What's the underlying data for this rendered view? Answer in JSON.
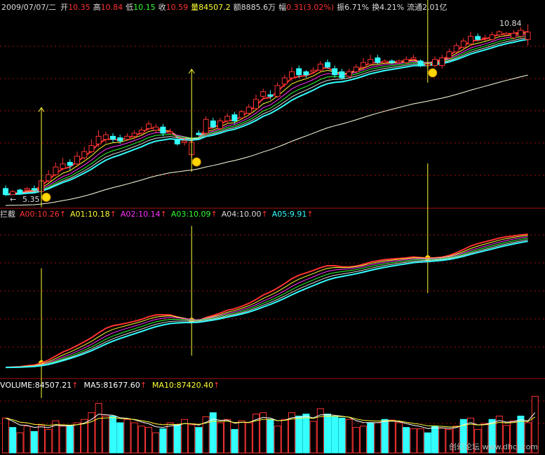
{
  "header": {
    "date": "2009/07/07/二",
    "open_label": "开",
    "open": "10.35",
    "high_label": "高",
    "high": "10.84",
    "low_label": "低",
    "low": "10.15",
    "close_label": "收",
    "close": "10.59",
    "volume_label": "量",
    "volume": "84507.2",
    "amount_label": "额",
    "amount": "8885.6万",
    "change_label": "幅",
    "change": "0.31(3.02%)",
    "amplitude_label": "振",
    "amplitude": "6.71%",
    "turnover_label": "换",
    "turnover": "4.21%",
    "float_label": "流通",
    "float": "2.01亿"
  },
  "indicator": {
    "name": "拦截",
    "lines": [
      {
        "label": "A00:10.26",
        "color": "#ff3333"
      },
      {
        "label": "A01:10.18",
        "color": "#ffff33"
      },
      {
        "label": "A02:10.14",
        "color": "#ff33ff"
      },
      {
        "label": "A03:10.09",
        "color": "#33ff33"
      },
      {
        "label": "A04:10.00",
        "color": "#dddddd"
      },
      {
        "label": "A05:9.91",
        "color": "#33ffff"
      }
    ]
  },
  "volume_panel": {
    "lines": [
      {
        "label": "VOLUME:84507.21",
        "color": "#ffffff"
      },
      {
        "label": "MA5:81677.60",
        "color": "#ffffff"
      },
      {
        "label": "MA10:87420.40",
        "color": "#ffff33"
      }
    ]
  },
  "colors": {
    "up": "#ff3333",
    "down": "#33ffff",
    "signal": "#ffff33",
    "grid": "#a01010",
    "ma_long": "#ffffe0"
  },
  "watermark": "创幻论坛 www.dhcj.com",
  "chart_data": [
    {
      "type": "candlestick",
      "annotations": [
        {
          "text": "10.84",
          "at": "high"
        },
        {
          "text": "5.35",
          "at": "low"
        }
      ],
      "candles": [
        {
          "o": 5.5,
          "c": 5.3,
          "h": 5.6,
          "l": 5.25
        },
        {
          "o": 5.3,
          "c": 5.4,
          "h": 5.45,
          "l": 5.3
        },
        {
          "o": 5.45,
          "c": 5.35,
          "h": 5.5,
          "l": 5.3
        },
        {
          "o": 5.45,
          "c": 5.5,
          "h": 5.55,
          "l": 5.4
        },
        {
          "o": 5.5,
          "c": 5.45,
          "h": 5.6,
          "l": 5.4
        },
        {
          "o": 5.4,
          "c": 5.75,
          "h": 5.85,
          "l": 5.35
        },
        {
          "o": 5.75,
          "c": 5.95,
          "h": 6.1,
          "l": 5.7
        },
        {
          "o": 5.95,
          "c": 6.2,
          "h": 6.35,
          "l": 5.9
        },
        {
          "o": 6.15,
          "c": 6.3,
          "h": 6.5,
          "l": 6.1
        },
        {
          "o": 6.35,
          "c": 6.25,
          "h": 6.45,
          "l": 6.1
        },
        {
          "o": 6.3,
          "c": 6.55,
          "h": 6.7,
          "l": 6.2
        },
        {
          "o": 6.5,
          "c": 6.7,
          "h": 6.85,
          "l": 6.45
        },
        {
          "o": 6.7,
          "c": 6.9,
          "h": 7.1,
          "l": 6.65
        },
        {
          "o": 6.95,
          "c": 7.2,
          "h": 7.4,
          "l": 6.85
        },
        {
          "o": 7.1,
          "c": 7.25,
          "h": 7.35,
          "l": 7.0
        },
        {
          "o": 7.2,
          "c": 7.1,
          "h": 7.3,
          "l": 7.0
        },
        {
          "o": 7.15,
          "c": 7.05,
          "h": 7.25,
          "l": 6.95
        },
        {
          "o": 7.1,
          "c": 7.2,
          "h": 7.3,
          "l": 7.05
        },
        {
          "o": 7.2,
          "c": 7.3,
          "h": 7.4,
          "l": 7.1
        },
        {
          "o": 7.3,
          "c": 7.4,
          "h": 7.5,
          "l": 7.25
        },
        {
          "o": 7.45,
          "c": 7.6,
          "h": 7.7,
          "l": 7.4
        },
        {
          "o": 7.4,
          "c": 7.5,
          "h": 7.6,
          "l": 7.3
        },
        {
          "o": 7.5,
          "c": 7.3,
          "h": 7.6,
          "l": 7.2
        },
        {
          "o": 7.3,
          "c": 7.35,
          "h": 7.45,
          "l": 7.25
        },
        {
          "o": 7.1,
          "c": 6.95,
          "h": 7.2,
          "l": 6.9
        },
        {
          "o": 7.0,
          "c": 7.05,
          "h": 7.15,
          "l": 6.9
        },
        {
          "o": 6.6,
          "c": 7.0,
          "h": 7.1,
          "l": 6.5
        },
        {
          "o": 7.3,
          "c": 7.25,
          "h": 7.4,
          "l": 7.2
        },
        {
          "o": 7.3,
          "c": 7.75,
          "h": 7.85,
          "l": 7.2
        },
        {
          "o": 7.7,
          "c": 7.5,
          "h": 7.8,
          "l": 7.45
        },
        {
          "o": 7.45,
          "c": 7.7,
          "h": 7.8,
          "l": 7.4
        },
        {
          "o": 7.7,
          "c": 7.85,
          "h": 7.95,
          "l": 7.6
        },
        {
          "o": 7.9,
          "c": 7.7,
          "h": 8.0,
          "l": 7.6
        },
        {
          "o": 7.8,
          "c": 8.0,
          "h": 8.05,
          "l": 7.75
        },
        {
          "o": 7.95,
          "c": 8.15,
          "h": 8.25,
          "l": 7.9
        },
        {
          "o": 8.1,
          "c": 8.4,
          "h": 8.55,
          "l": 8.05
        },
        {
          "o": 8.5,
          "c": 8.65,
          "h": 8.75,
          "l": 8.4
        },
        {
          "o": 8.55,
          "c": 8.5,
          "h": 8.7,
          "l": 8.4
        },
        {
          "o": 8.5,
          "c": 8.85,
          "h": 8.95,
          "l": 8.45
        },
        {
          "o": 8.9,
          "c": 9.1,
          "h": 9.2,
          "l": 8.8
        },
        {
          "o": 9.1,
          "c": 9.3,
          "h": 9.45,
          "l": 9.0
        },
        {
          "o": 9.4,
          "c": 9.2,
          "h": 9.5,
          "l": 9.1
        },
        {
          "o": 9.3,
          "c": 9.2,
          "h": 9.35,
          "l": 9.1
        },
        {
          "o": 9.3,
          "c": 9.35,
          "h": 9.45,
          "l": 9.25
        },
        {
          "o": 9.35,
          "c": 9.55,
          "h": 9.65,
          "l": 9.3
        },
        {
          "o": 9.6,
          "c": 9.45,
          "h": 9.7,
          "l": 9.4
        },
        {
          "o": 9.4,
          "c": 9.2,
          "h": 9.5,
          "l": 9.1
        },
        {
          "o": 9.3,
          "c": 9.1,
          "h": 9.4,
          "l": 9.05
        },
        {
          "o": 9.15,
          "c": 9.3,
          "h": 9.4,
          "l": 9.1
        },
        {
          "o": 9.3,
          "c": 9.45,
          "h": 9.55,
          "l": 9.25
        },
        {
          "o": 9.45,
          "c": 9.6,
          "h": 9.75,
          "l": 9.35
        },
        {
          "o": 9.55,
          "c": 9.7,
          "h": 9.85,
          "l": 9.5
        },
        {
          "o": 9.75,
          "c": 9.6,
          "h": 9.85,
          "l": 9.55
        },
        {
          "o": 9.6,
          "c": 9.65,
          "h": 9.7,
          "l": 9.55
        },
        {
          "o": 9.65,
          "c": 9.6,
          "h": 9.7,
          "l": 9.55
        },
        {
          "o": 9.6,
          "c": 9.65,
          "h": 9.7,
          "l": 9.55
        },
        {
          "o": 9.6,
          "c": 9.7,
          "h": 9.8,
          "l": 9.55
        },
        {
          "o": 9.7,
          "c": 9.75,
          "h": 9.85,
          "l": 9.65
        },
        {
          "o": 9.65,
          "c": 9.5,
          "h": 9.7,
          "l": 9.45
        },
        {
          "o": 9.5,
          "c": 9.55,
          "h": 9.6,
          "l": 9.4
        },
        {
          "o": 9.5,
          "c": 9.7,
          "h": 9.8,
          "l": 9.45
        },
        {
          "o": 9.5,
          "c": 9.75,
          "h": 9.85,
          "l": 9.4
        },
        {
          "o": 9.75,
          "c": 9.95,
          "h": 10.05,
          "l": 9.7
        },
        {
          "o": 9.95,
          "c": 10.15,
          "h": 10.25,
          "l": 9.9
        },
        {
          "o": 10.1,
          "c": 10.3,
          "h": 10.4,
          "l": 10.0
        },
        {
          "o": 10.2,
          "c": 10.45,
          "h": 10.6,
          "l": 10.15
        },
        {
          "o": 10.45,
          "c": 10.35,
          "h": 10.55,
          "l": 10.3
        },
        {
          "o": 10.4,
          "c": 10.4,
          "h": 10.5,
          "l": 10.3
        },
        {
          "o": 10.35,
          "c": 10.5,
          "h": 10.6,
          "l": 10.3
        },
        {
          "o": 10.5,
          "c": 10.6,
          "h": 10.65,
          "l": 10.45
        },
        {
          "o": 10.5,
          "c": 10.55,
          "h": 10.6,
          "l": 10.45
        },
        {
          "o": 10.4,
          "c": 10.55,
          "h": 10.65,
          "l": 10.35
        },
        {
          "o": 10.45,
          "c": 10.65,
          "h": 10.75,
          "l": 10.4
        },
        {
          "o": 10.35,
          "c": 10.59,
          "h": 10.84,
          "l": 10.15
        }
      ],
      "buy_signals": [
        5,
        26,
        59
      ],
      "moving_averages": [
        "A00",
        "A01",
        "A02",
        "A03",
        "A04",
        "A05"
      ]
    },
    {
      "type": "bar",
      "name": "volume",
      "values": [
        52,
        38,
        30,
        40,
        32,
        41,
        35,
        48,
        40,
        40,
        45,
        50,
        60,
        74,
        55,
        55,
        45,
        50,
        45,
        40,
        38,
        30,
        36,
        45,
        42,
        50,
        42,
        38,
        54,
        60,
        45,
        50,
        35,
        48,
        45,
        58,
        60,
        50,
        40,
        50,
        60,
        55,
        58,
        47,
        66,
        58,
        54,
        52,
        50,
        38,
        40,
        45,
        45,
        50,
        49,
        45,
        38,
        36,
        36,
        30,
        40,
        37,
        35,
        40,
        50,
        52,
        35,
        44,
        50,
        55,
        41,
        48,
        55,
        45,
        84.5
      ],
      "volume_up": [
        true,
        false,
        true,
        true,
        false,
        true,
        true,
        true,
        true,
        false,
        true,
        true,
        true,
        true,
        true,
        false,
        false,
        true,
        true,
        true,
        true,
        true,
        false,
        true,
        false,
        true,
        true,
        false,
        true,
        false,
        true,
        true,
        false,
        true,
        true,
        true,
        true,
        false,
        true,
        true,
        true,
        false,
        false,
        true,
        true,
        false,
        false,
        false,
        true,
        true,
        true,
        false,
        true,
        false,
        true,
        true,
        false,
        true,
        true,
        false,
        false,
        true,
        true,
        true,
        false,
        true,
        true,
        true,
        false,
        true,
        true,
        true,
        false,
        true,
        true
      ]
    }
  ]
}
